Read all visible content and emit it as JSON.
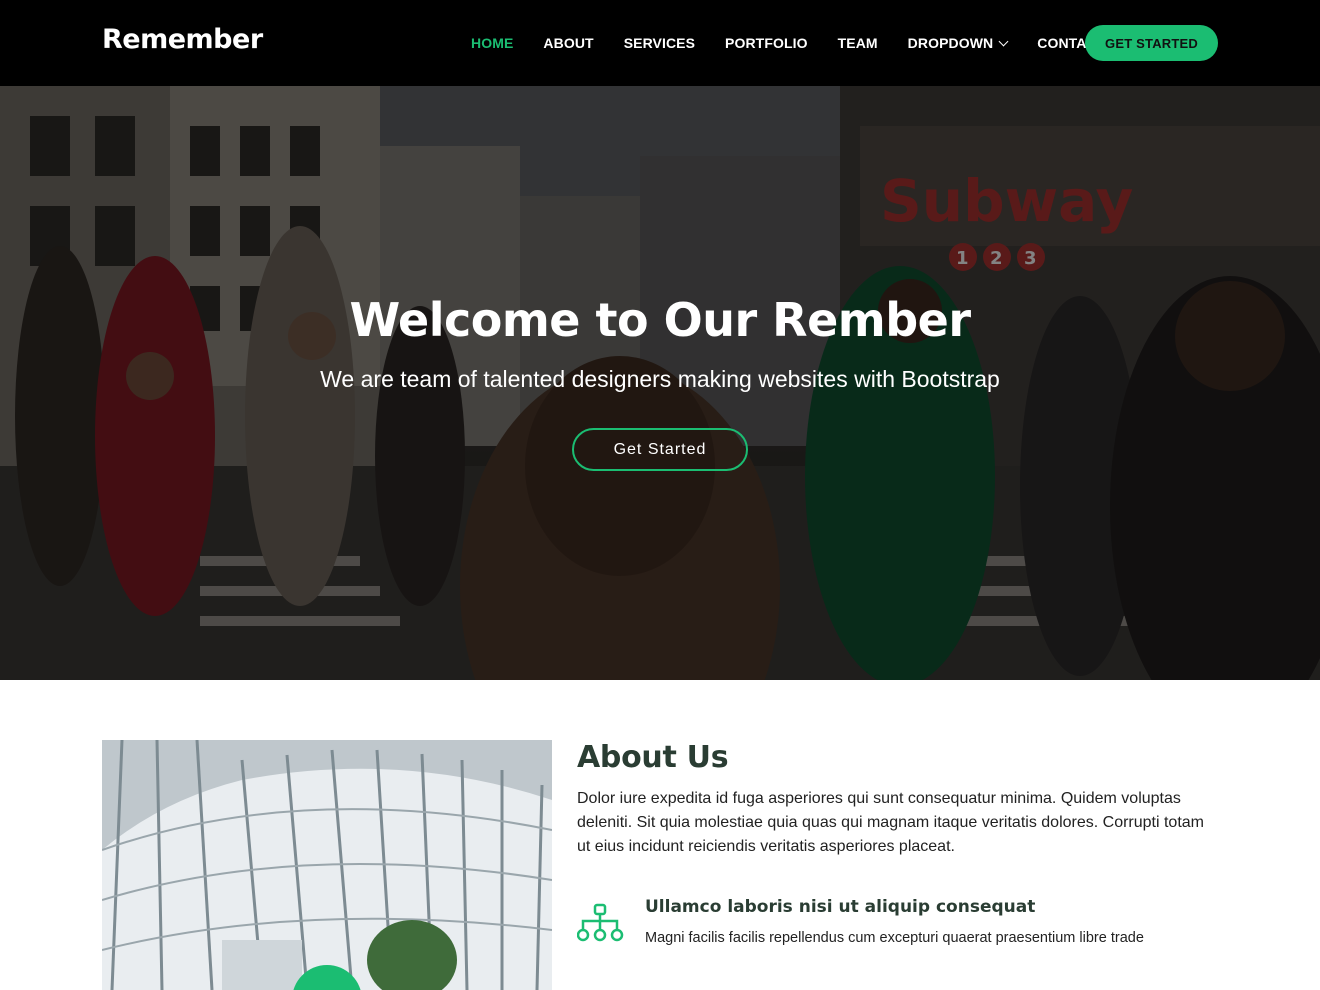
{
  "header": {
    "logo": "Remember",
    "nav": [
      {
        "label": "HOME",
        "active": true
      },
      {
        "label": "ABOUT"
      },
      {
        "label": "SERVICES"
      },
      {
        "label": "PORTFOLIO"
      },
      {
        "label": "TEAM"
      },
      {
        "label": "DROPDOWN",
        "icon": "chevron-down-icon"
      },
      {
        "label": "CONTACT"
      }
    ],
    "cta_label": "GET STARTED"
  },
  "hero": {
    "title": "Welcome to Our Rember",
    "subtitle": "We are team of talented designers making websites with Bootstrap",
    "button_label": "Get Started",
    "sign_text": "Subway",
    "sign_numbers": [
      "1",
      "2",
      "3"
    ]
  },
  "about": {
    "title": "About Us",
    "text": "Dolor iure expedita id fuga asperiores qui sunt consequatur minima. Quidem voluptas deleniti. Sit quia molestiae quia quas qui magnam itaque veritatis dolores. Corrupti totam ut eius incidunt reiciendis veritatis asperiores placeat.",
    "feature": {
      "icon": "sitemap-icon",
      "title": "Ullamco laboris nisi ut aliquip consequat",
      "text": "Magni facilis facilis repellendus cum excepturi quaerat praesentium libre trade"
    }
  },
  "colors": {
    "accent": "#1bbd72",
    "header_bg": "#000000",
    "heading": "#2a3d33"
  }
}
